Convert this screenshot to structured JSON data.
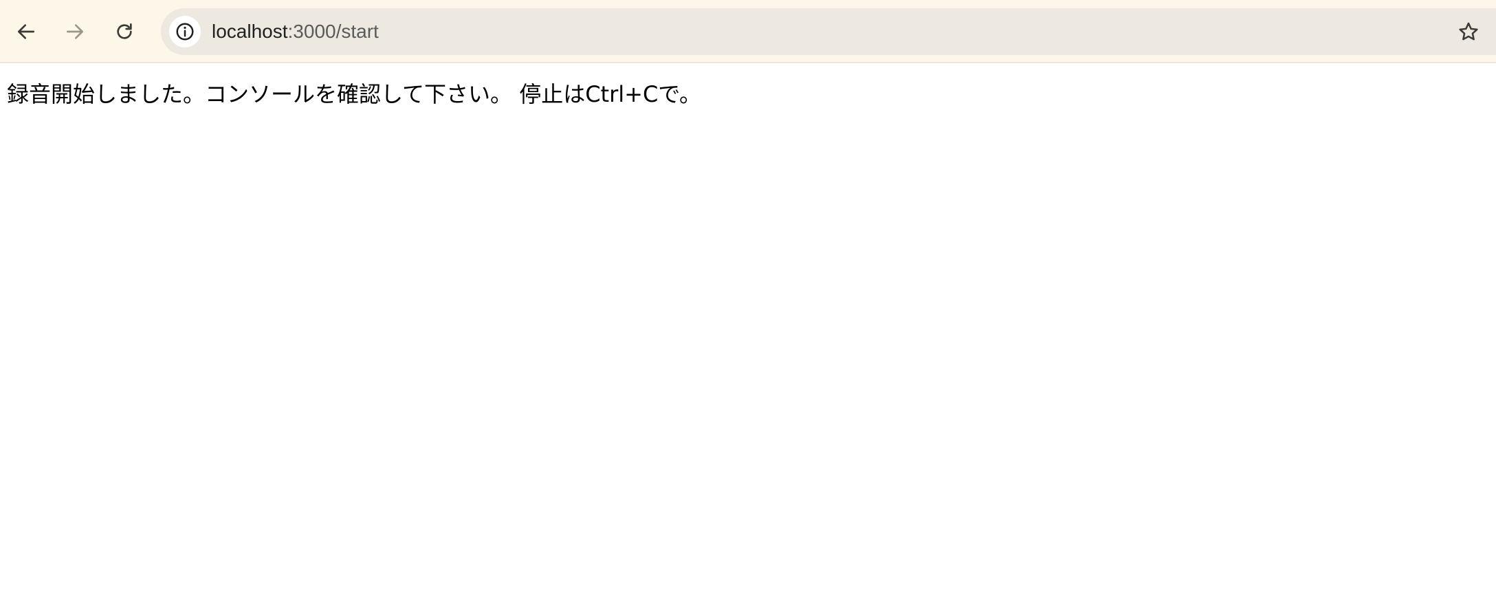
{
  "browser": {
    "url_host": "localhost",
    "url_path": ":3000/start",
    "icons": {
      "back": "arrow-left-icon",
      "forward": "arrow-right-icon",
      "reload": "reload-icon",
      "site_info": "info-icon",
      "bookmark": "star-icon"
    },
    "colors": {
      "toolbar_bg": "#fdf7ea",
      "omnibox_bg": "#ede8e0",
      "forward_disabled": "#9b958c"
    }
  },
  "page": {
    "message": "録音開始しました。コンソールを確認して下さい。 停止はCtrl+Cで。"
  }
}
